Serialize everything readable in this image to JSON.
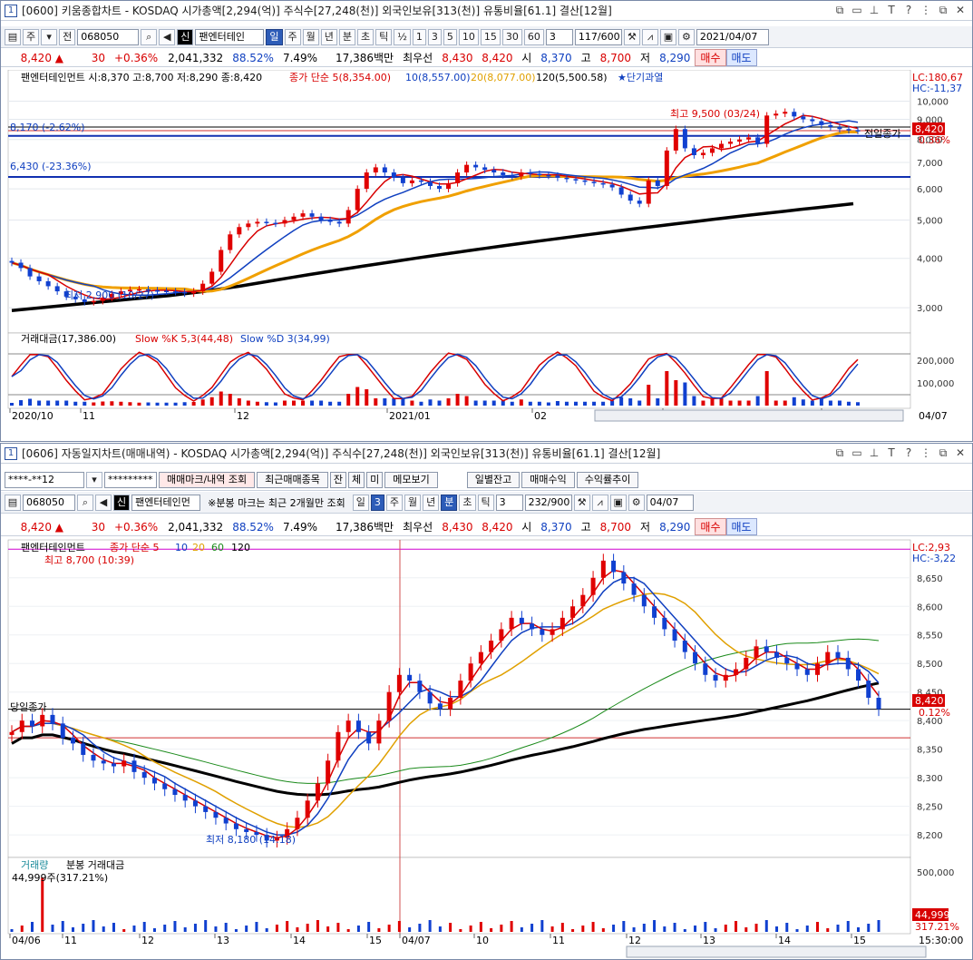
{
  "top": {
    "window_num": "1",
    "title": "[0600] 키움종합차트 - KOSDAQ 시가총액[2,294(억)] 주식수[27,248(천)] 외국인보유[313(천)] 유통비율[61.1] 결산[12월]",
    "toolbar": {
      "mode1": "주",
      "mode2": "전",
      "code": "068050",
      "shin": "신",
      "name": "팬엔터테인",
      "periods": [
        "일",
        "주",
        "월",
        "년",
        "분",
        "초",
        "틱"
      ],
      "minutes": [
        "½",
        "1",
        "3",
        "5",
        "10",
        "15",
        "30",
        "60"
      ],
      "count_sel": "3",
      "count": "117/600",
      "date": "2021/04/07"
    },
    "quote": {
      "price": "8,420 ▲",
      "change": "30",
      "pct": "+0.36%",
      "volume": "2,041,332",
      "ratio": "88.52%",
      "turnover": "7.49%",
      "amount": "17,386백만",
      "best_label": "최우선",
      "best_ask": "8,430",
      "best_bid": "8,420",
      "open_label": "시",
      "open": "8,370",
      "high_label": "고",
      "high": "8,700",
      "low_label": "저",
      "low": "8,290",
      "buy": "매수",
      "sell": "매도"
    }
  },
  "bottom": {
    "window_num": "1",
    "title": "[0606] 자동일지차트(매매내역) - KOSDAQ 시가총액[2,294(억)] 주식수[27,248(천)] 외국인보유[313(천)] 유통비율[61.1] 결산[12월]",
    "account": "****-**12",
    "password": "*********",
    "buttons": [
      "매매마크/내역 조회",
      "최근매매종목",
      "잔",
      "체",
      "미",
      "메모보기",
      "일별잔고",
      "매매수익",
      "수익률추이"
    ],
    "toolbar": {
      "code": "068050",
      "shin": "신",
      "name": "팬엔터테인먼",
      "note": "※분봉 마크는 최근 2개월만 조회",
      "period_day": "일",
      "day_count": "3",
      "periods": [
        "주",
        "월",
        "년",
        "분",
        "초",
        "틱"
      ],
      "min_sel": "3",
      "count": "232/900",
      "date": "04/07"
    }
  },
  "chart_data": [
    {
      "type": "candlestick",
      "legend": [
        "팬엔터테인먼트 시:8,370 고:8,700 저:8,290 종:8,420",
        "종가 단순 5(8,354.00)",
        "10(8,557.00)",
        "20(8,077.00)",
        "120(5,500.58)",
        "★단기과열"
      ],
      "x_labels": [
        "2020/10",
        "11",
        "12",
        "2021/01",
        "02",
        "03",
        "04",
        "04/07"
      ],
      "y_ticks": [
        "10,000",
        "9,000",
        "8,000",
        "7,000",
        "6,000",
        "5,000",
        "4,000",
        "3,000"
      ],
      "y_scale": "log",
      "ylim": [
        2700,
        10800
      ],
      "lc_label": "LC:180,67",
      "hc_label": "HC:-11,37",
      "hlines": [
        {
          "label": "8,170 (-2.62%)",
          "value": 8170
        },
        {
          "label": "6,430 (-23.36%)",
          "value": 6430
        }
      ],
      "annotations": {
        "high": "최고 9,500 (03/24)",
        "low": "최저 2,900 (10/27)",
        "prev_close": "전일종가"
      },
      "last_price": "8,420",
      "last_pct": "0.36%",
      "close_series": [
        3900,
        3780,
        3600,
        3500,
        3400,
        3300,
        3200,
        3150,
        3100,
        3120,
        3180,
        3250,
        3300,
        3330,
        3340,
        3320,
        3310,
        3300,
        3290,
        3260,
        3300,
        3450,
        3700,
        4200,
        4600,
        4800,
        4900,
        4950,
        4920,
        4900,
        5000,
        5100,
        5200,
        5100,
        5000,
        4950,
        4900,
        5300,
        6000,
        6600,
        6800,
        6600,
        6400,
        6200,
        6300,
        6250,
        6100,
        6000,
        6200,
        6600,
        6900,
        6800,
        6700,
        6600,
        6500,
        6450,
        6600,
        6550,
        6500,
        6480,
        6400,
        6350,
        6300,
        6250,
        6200,
        6150,
        6050,
        5800,
        5600,
        5500,
        6300,
        6100,
        7500,
        8500,
        7600,
        7300,
        7400,
        7600,
        7800,
        7900,
        8000,
        8100,
        7800,
        9200,
        9300,
        9400,
        9150,
        9000,
        8900,
        8700,
        8600,
        8500,
        8450,
        8420
      ],
      "ma120": [
        2950,
        2980,
        3010,
        3040,
        3070,
        3100,
        3130,
        3160,
        3190,
        3220,
        3260,
        3300,
        3350,
        3400,
        3460,
        3520,
        3580,
        3640,
        3700,
        3760,
        3820,
        3880,
        3940,
        4000,
        4060,
        4120,
        4180,
        4240,
        4300,
        4360,
        4420,
        4480,
        4540,
        4600,
        4660,
        4720,
        4780,
        4840,
        4900,
        4960,
        5020,
        5080,
        5140,
        5200,
        5260,
        5320,
        5380,
        5440,
        5500
      ],
      "indicator": {
        "legend": [
          "거래대금(17,386.00)",
          "Slow %K 5,3(44,48)",
          "Slow %D 3(34,99)"
        ],
        "y_ticks": [
          "200,000",
          "100,000"
        ]
      },
      "nav_label": "04/07"
    },
    {
      "type": "candlestick",
      "legend": [
        "팬엔터테인먼트",
        "종가 단순 5",
        "10",
        "20",
        "60",
        "120"
      ],
      "x_labels": [
        "04/06",
        "11",
        "12",
        "13",
        "14",
        "15",
        "04/07",
        "10",
        "11",
        "12",
        "13",
        "14",
        "15",
        "15:30:00"
      ],
      "y_ticks": [
        "8,650",
        "8,600",
        "8,550",
        "8,500",
        "8,450",
        "8,400",
        "8,350",
        "8,300",
        "8,250",
        "8,200"
      ],
      "ylim": [
        8170,
        8710
      ],
      "lc_label": "LC:2,93",
      "hc_label": "HC:-3,22",
      "annotations": {
        "high": "최고 8,700 (10:39)",
        "low": "최저 8,180 (14:18)",
        "prev_close": "당일종가"
      },
      "last_price": "8,420",
      "last_pct": "0.12%",
      "close_series": [
        8380,
        8400,
        8390,
        8410,
        8395,
        8370,
        8360,
        8340,
        8330,
        8325,
        8320,
        8330,
        8310,
        8300,
        8290,
        8280,
        8270,
        8260,
        8250,
        8240,
        8230,
        8220,
        8210,
        8205,
        8200,
        8190,
        8195,
        8210,
        8230,
        8260,
        8290,
        8330,
        8380,
        8400,
        8380,
        8360,
        8400,
        8450,
        8480,
        8470,
        8450,
        8430,
        8420,
        8440,
        8470,
        8500,
        8520,
        8540,
        8560,
        8580,
        8570,
        8560,
        8550,
        8560,
        8580,
        8600,
        8620,
        8650,
        8680,
        8660,
        8640,
        8620,
        8600,
        8580,
        8560,
        8540,
        8520,
        8500,
        8480,
        8470,
        8480,
        8490,
        8510,
        8530,
        8520,
        8510,
        8500,
        8490,
        8480,
        8500,
        8520,
        8510,
        8490,
        8470,
        8440,
        8420
      ],
      "volume": {
        "legend": [
          "거래량",
          "분봉 거래대금"
        ],
        "left_label": "44,999주(317.21%)",
        "y_tick": "500,000",
        "last": "44,999",
        "last_pct": "317.21%"
      }
    }
  ]
}
